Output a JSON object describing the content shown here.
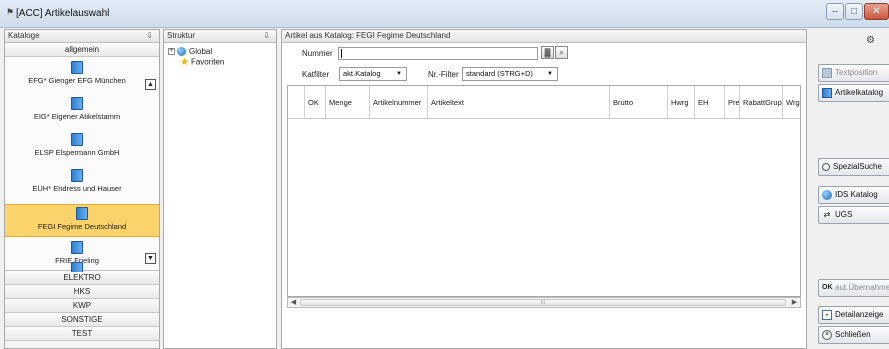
{
  "window": {
    "title": "[ACC] Artikelauswahl",
    "controls": [
      "–",
      "□",
      "✕"
    ]
  },
  "kataloge": {
    "header": "Kataloge",
    "pin": "⇩",
    "group_allgemein": "allgemein",
    "items": [
      {
        "label": "EFG* Gienger EFG München"
      },
      {
        "label": "EIG* Eigener Atikelstamm"
      },
      {
        "label": "ELSP Elspermann GmbH"
      },
      {
        "label": "EUH* Endress und Hauser"
      },
      {
        "label": "FEGI Fegime Deutschland",
        "selected": true
      },
      {
        "label": "FRIE Frieling"
      }
    ],
    "groups": [
      "ELEKTRO",
      "HKS",
      "KWP",
      "SONSTIGE",
      "TEST"
    ],
    "scroll_up": "▲",
    "scroll_down": "▼"
  },
  "struktur": {
    "header": "Struktur",
    "pin": "⇩",
    "tree": [
      {
        "expander": "+",
        "label": "Global"
      },
      {
        "label": "Favoriten"
      }
    ]
  },
  "artikel": {
    "header": "Artikel aus Katalog: FEGI Fegime Deutschland",
    "nummer_label": "Nummer",
    "nummer_value": "",
    "katfilter_label": "Katfilter",
    "katfilter_value": "akt.Katalog",
    "nrfilter_label": "Nr.-Filter",
    "nrfilter_value": "standard (STRG+D)",
    "columns": [
      "OK",
      "Menge",
      "Artikelnummer",
      "Artikeltext",
      "Brutto",
      "Hwrg",
      "EH",
      "Prei",
      "RabattGrup",
      "Wrg"
    ],
    "hscroll_grip": "III"
  },
  "actions": {
    "textposition": "Textposition",
    "artikelkatalog": "Artikelkatalog",
    "spezialsuche": "SpezialSuche",
    "ids_katalog": "IDS Katalog",
    "ugs": "UGS",
    "aut_uebernahme": "aut.Übernahme",
    "detailanzeige": "Detailanzeige",
    "schliessen": "Schließen"
  }
}
